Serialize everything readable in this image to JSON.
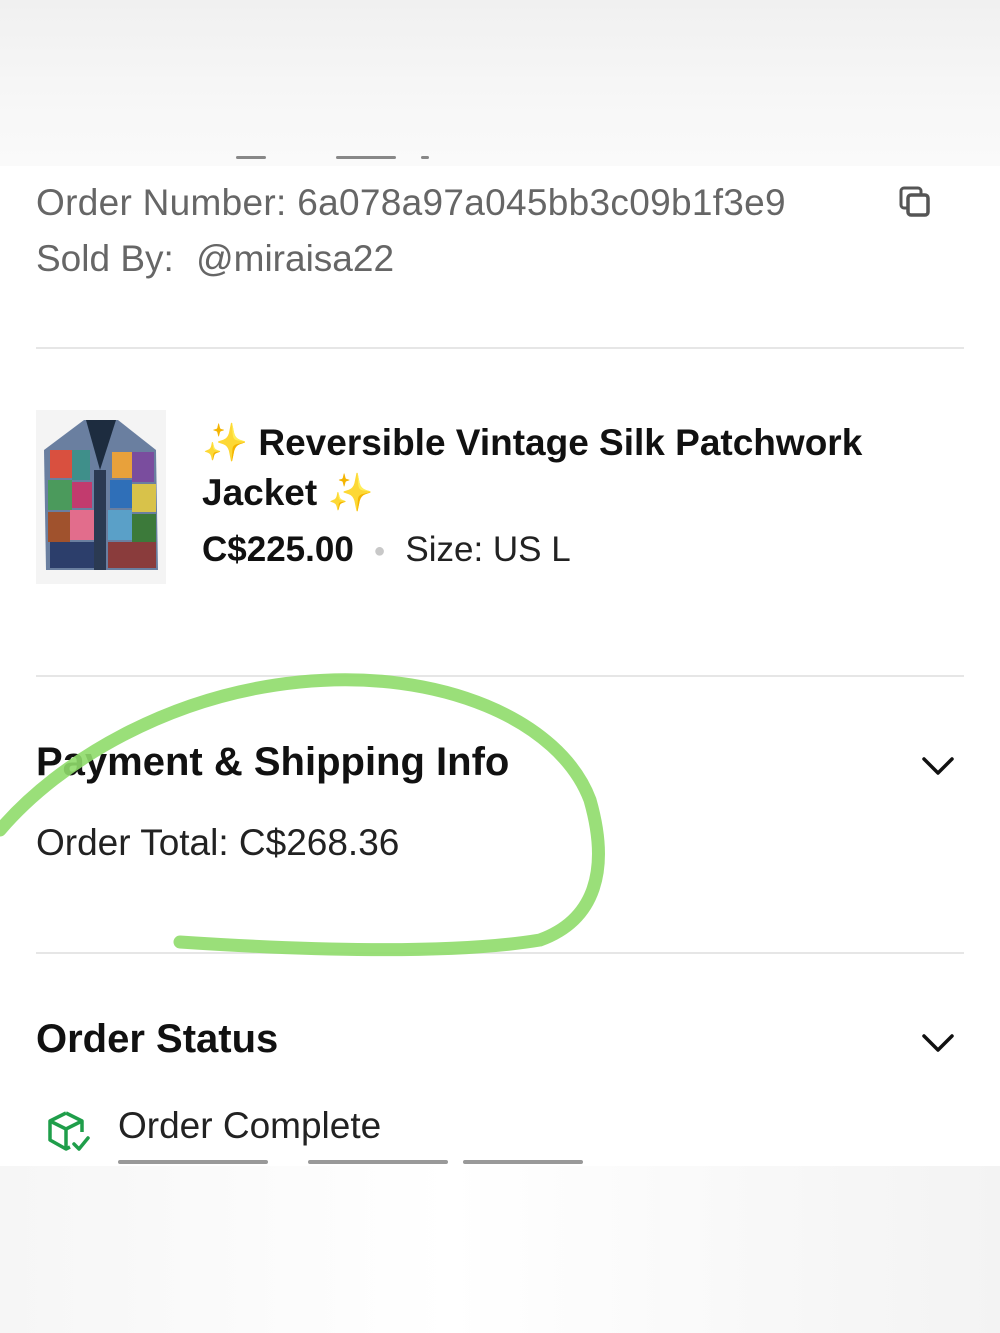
{
  "order": {
    "number_label": "Order Number:",
    "number_value": "6a078a97a045bb3c09b1f3e9",
    "sold_by_label": "Sold By:",
    "sold_by_value": "@miraisa22",
    "copy_icon": "copy-icon"
  },
  "item": {
    "sparkle": "✨",
    "title": "Reversible Vintage Silk Patchwork Jacket",
    "price": "C$225.00",
    "size_label": "Size:",
    "size_value": "US L"
  },
  "payment": {
    "title": "Payment & Shipping Info",
    "total_label": "Order Total:",
    "total_value": "C$268.36",
    "chevron_icon": "chevron-down-icon"
  },
  "status": {
    "title": "Order Status",
    "label": "Order Complete",
    "icon": "package-check-icon",
    "chevron_icon": "chevron-down-icon"
  },
  "colors": {
    "annotation": "#8fdc6a",
    "status_icon": "#1f9e4a",
    "muted_text": "#666666"
  }
}
